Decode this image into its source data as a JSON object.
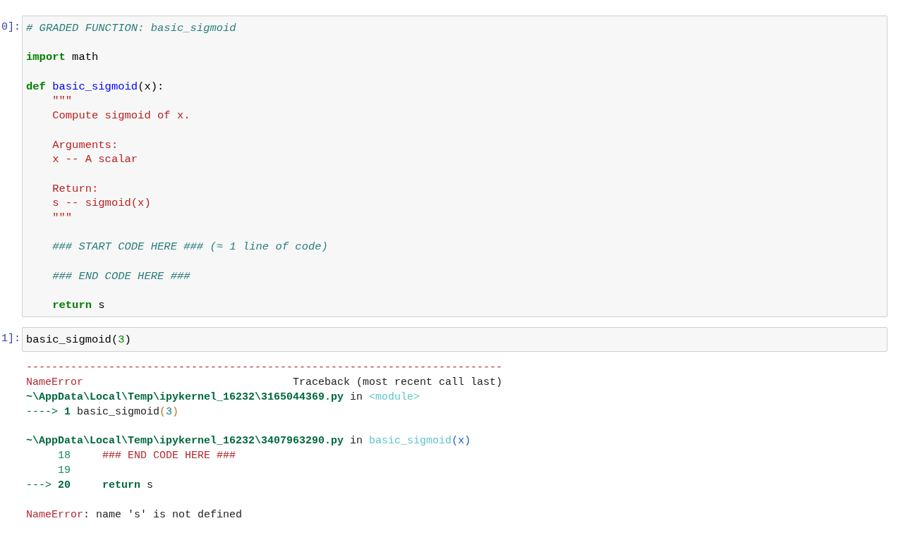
{
  "cells": [
    {
      "prompt": "0]:",
      "lines": [
        {
          "kind": "code",
          "indent": false,
          "tokens": [
            {
              "kind": "comment",
              "text": "# GRADED FUNCTION: basic_sigmoid"
            }
          ]
        },
        {
          "kind": "blank"
        },
        {
          "kind": "code",
          "indent": false,
          "tokens": [
            {
              "kind": "keyword",
              "text": "import"
            },
            {
              "kind": "plain",
              "text": " math"
            }
          ]
        },
        {
          "kind": "blank"
        },
        {
          "kind": "code",
          "indent": false,
          "tokens": [
            {
              "kind": "keyword",
              "text": "def"
            },
            {
              "kind": "func",
              "text": " basic_sigmoid"
            },
            {
              "kind": "plain",
              "text": "(x):"
            }
          ]
        },
        {
          "kind": "code",
          "indent": true,
          "tokens": [
            {
              "kind": "string",
              "text": "\"\"\""
            }
          ]
        },
        {
          "kind": "code",
          "indent": true,
          "tokens": [
            {
              "kind": "string",
              "text": "Compute sigmoid of x."
            }
          ]
        },
        {
          "kind": "blank"
        },
        {
          "kind": "code",
          "indent": true,
          "tokens": [
            {
              "kind": "string",
              "text": "Arguments:"
            }
          ]
        },
        {
          "kind": "code",
          "indent": true,
          "tokens": [
            {
              "kind": "string",
              "text": "x -- A scalar"
            }
          ]
        },
        {
          "kind": "blank"
        },
        {
          "kind": "code",
          "indent": true,
          "tokens": [
            {
              "kind": "string",
              "text": "Return:"
            }
          ]
        },
        {
          "kind": "code",
          "indent": true,
          "tokens": [
            {
              "kind": "string",
              "text": "s -- sigmoid(x)"
            }
          ]
        },
        {
          "kind": "code",
          "indent": true,
          "tokens": [
            {
              "kind": "string",
              "text": "\"\"\""
            }
          ]
        },
        {
          "kind": "blank"
        },
        {
          "kind": "code",
          "indent": true,
          "tokens": [
            {
              "kind": "comment",
              "text": "### START CODE HERE ### (≈ 1 line of code)"
            }
          ]
        },
        {
          "kind": "blank"
        },
        {
          "kind": "code",
          "indent": true,
          "tokens": [
            {
              "kind": "comment",
              "text": "### END CODE HERE ###"
            }
          ]
        },
        {
          "kind": "blank"
        },
        {
          "kind": "code",
          "indent": true,
          "tokens": [
            {
              "kind": "keyword",
              "text": "return"
            },
            {
              "kind": "plain",
              "text": " s"
            }
          ]
        }
      ]
    },
    {
      "prompt": "1]:",
      "lines": [
        {
          "kind": "code",
          "indent": false,
          "tokens": [
            {
              "kind": "plain",
              "text": "basic_sigmoid("
            },
            {
              "kind": "number",
              "text": "3"
            },
            {
              "kind": "plain",
              "text": ")"
            }
          ]
        }
      ],
      "output": [
        {
          "kind": "rule",
          "tokens": [
            {
              "kind": "error",
              "text": "---------------------------------------------------------------------------"
            }
          ]
        },
        {
          "kind": "text",
          "tokens": [
            {
              "kind": "error",
              "text": "NameError"
            },
            {
              "kind": "plain",
              "text": "                                 Traceback (most recent call last)"
            }
          ]
        },
        {
          "kind": "text",
          "tokens": [
            {
              "kind": "path",
              "text": "~\\AppData\\Local\\Temp\\ipykernel_16232\\3165044369.py"
            },
            {
              "kind": "plain",
              "text": " in "
            },
            {
              "kind": "name",
              "text": "<module>"
            }
          ]
        },
        {
          "kind": "text",
          "tokens": [
            {
              "kind": "arrow",
              "text": "----> "
            },
            {
              "kind": "lineno_bold",
              "text": "1"
            },
            {
              "kind": "plain",
              "text": " basic_sigmoid"
            },
            {
              "kind": "paren",
              "text": "("
            },
            {
              "kind": "num",
              "text": "3"
            },
            {
              "kind": "paren",
              "text": ")"
            }
          ]
        },
        {
          "kind": "blank"
        },
        {
          "kind": "text",
          "tokens": [
            {
              "kind": "path",
              "text": "~\\AppData\\Local\\Temp\\ipykernel_16232\\3407963290.py"
            },
            {
              "kind": "plain",
              "text": " in "
            },
            {
              "kind": "name",
              "text": "basic_sigmoid"
            },
            {
              "kind": "args",
              "text": "(x)"
            }
          ]
        },
        {
          "kind": "text",
          "tokens": [
            {
              "kind": "lineno",
              "text": "     18"
            },
            {
              "kind": "error",
              "text": "     ### END CODE HERE ###"
            }
          ]
        },
        {
          "kind": "text",
          "tokens": [
            {
              "kind": "lineno",
              "text": "     19"
            }
          ]
        },
        {
          "kind": "text",
          "tokens": [
            {
              "kind": "arrow",
              "text": "---> "
            },
            {
              "kind": "lineno_bold",
              "text": "20"
            },
            {
              "kind": "lineno_bold",
              "text": "     return"
            },
            {
              "kind": "plain",
              "text": " s"
            }
          ]
        },
        {
          "kind": "blank"
        },
        {
          "kind": "text",
          "tokens": [
            {
              "kind": "error",
              "text": "NameError"
            },
            {
              "kind": "plain",
              "text": ": name 's' is not defined"
            }
          ]
        }
      ]
    }
  ]
}
